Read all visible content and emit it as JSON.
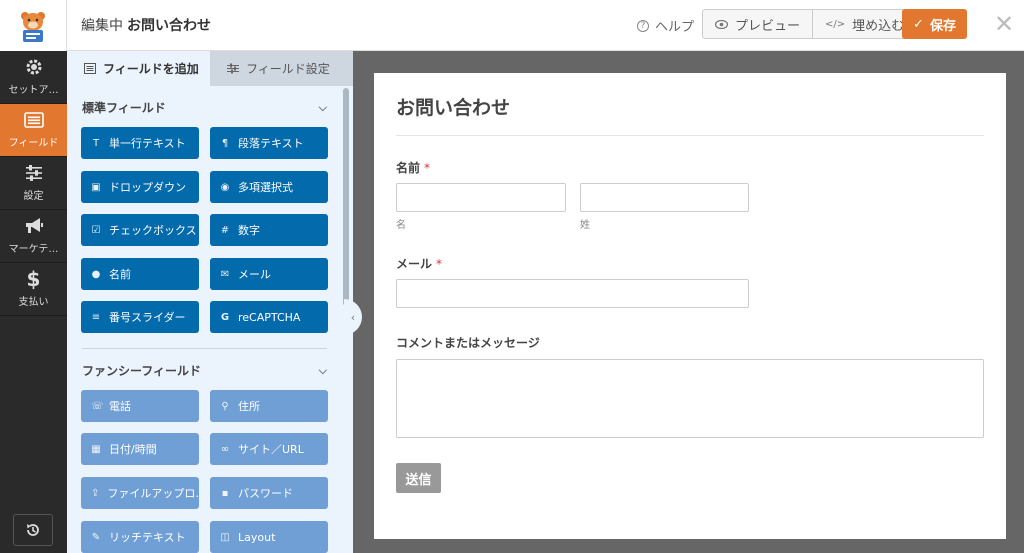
{
  "header": {
    "editing_label": "編集中",
    "form_name": "お問い合わせ",
    "help_label": "ヘルプ",
    "preview_label": "プレビュー",
    "embed_label": "埋め込む",
    "save_label": "保存"
  },
  "sidebar": {
    "items": [
      {
        "label": "セットア…",
        "icon": "gear-icon"
      },
      {
        "label": "フィールド",
        "icon": "fields-list-icon"
      },
      {
        "label": "設定",
        "icon": "sliders-icon"
      },
      {
        "label": "マーケテ…",
        "icon": "megaphone-icon"
      },
      {
        "label": "支払い",
        "icon": "dollar-icon"
      }
    ],
    "revisions_icon": "history-icon"
  },
  "panel": {
    "tabs": [
      {
        "label": "フィールドを追加",
        "icon": "list-icon"
      },
      {
        "label": "フィールド設定",
        "icon": "sliders-icon"
      }
    ],
    "standard_title": "標準フィールド",
    "standard_fields": [
      {
        "label": "単一行テキスト",
        "icon": "text-icon"
      },
      {
        "label": "段落テキスト",
        "icon": "paragraph-icon"
      },
      {
        "label": "ドロップダウン",
        "icon": "dropdown-icon"
      },
      {
        "label": "多項選択式",
        "icon": "radio-icon"
      },
      {
        "label": "チェックボックス",
        "icon": "checkbox-icon"
      },
      {
        "label": "数字",
        "icon": "hash-icon"
      },
      {
        "label": "名前",
        "icon": "user-icon"
      },
      {
        "label": "メール",
        "icon": "envelope-icon"
      },
      {
        "label": "番号スライダー",
        "icon": "slider-icon"
      },
      {
        "label": "reCAPTCHA",
        "icon": "google-icon"
      }
    ],
    "fancy_title": "ファンシーフィールド",
    "fancy_fields": [
      {
        "label": "電話",
        "icon": "phone-icon"
      },
      {
        "label": "住所",
        "icon": "map-pin-icon"
      },
      {
        "label": "日付/時間",
        "icon": "calendar-icon"
      },
      {
        "label": "サイト／URL",
        "icon": "link-icon"
      },
      {
        "label": "ファイルアップロ…",
        "icon": "upload-icon"
      },
      {
        "label": "パスワード",
        "icon": "lock-icon"
      },
      {
        "label": "リッチテキスト",
        "icon": "edit-icon"
      },
      {
        "label": "Layout",
        "icon": "layout-icon"
      }
    ]
  },
  "form": {
    "title": "お問い合わせ",
    "name_label": "名前",
    "first_sublabel": "名",
    "last_sublabel": "姓",
    "email_label": "メール",
    "comment_label": "コメントまたはメッセージ",
    "required_mark": "*",
    "submit_label": "送信"
  },
  "colors": {
    "accent": "#e27730",
    "standard_button": "#036aab",
    "fancy_button": "#6f9fd4",
    "sidebar_bg": "#2a2a2a"
  }
}
